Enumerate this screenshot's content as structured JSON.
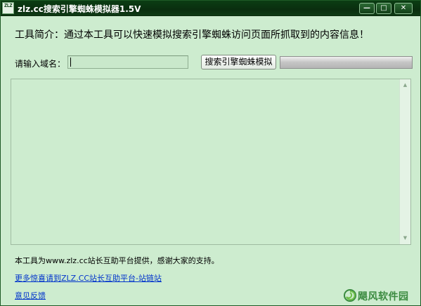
{
  "window": {
    "title": "zlz.cc搜索引擎蜘蛛模拟器1.5V",
    "icon_label": "ZLZ",
    "controls": {
      "minimize": "—",
      "maximize": "□",
      "close": "✕"
    }
  },
  "main": {
    "intro": "工具简介：通过本工具可以快速模拟搜索引擎蜘蛛访问页面所抓取到的内容信息！",
    "domain_label": "请输入域名：",
    "domain_value": "",
    "simulate_button": "搜索引擎蜘蛛模拟",
    "progress": 0,
    "output_text": ""
  },
  "footer": {
    "provider_text": "本工具为www.zlz.cc站长互助平台提供，感谢大家的支持。",
    "more_link": "更多惊喜请到ZLZ.CC站长互助平台-站链站",
    "feedback_link": "意见反馈"
  },
  "watermark": {
    "text": "飓风软件园"
  },
  "colors": {
    "window_bg": "#cdeccf",
    "titlebar": "#0b3d13",
    "link": "#0033cc"
  }
}
